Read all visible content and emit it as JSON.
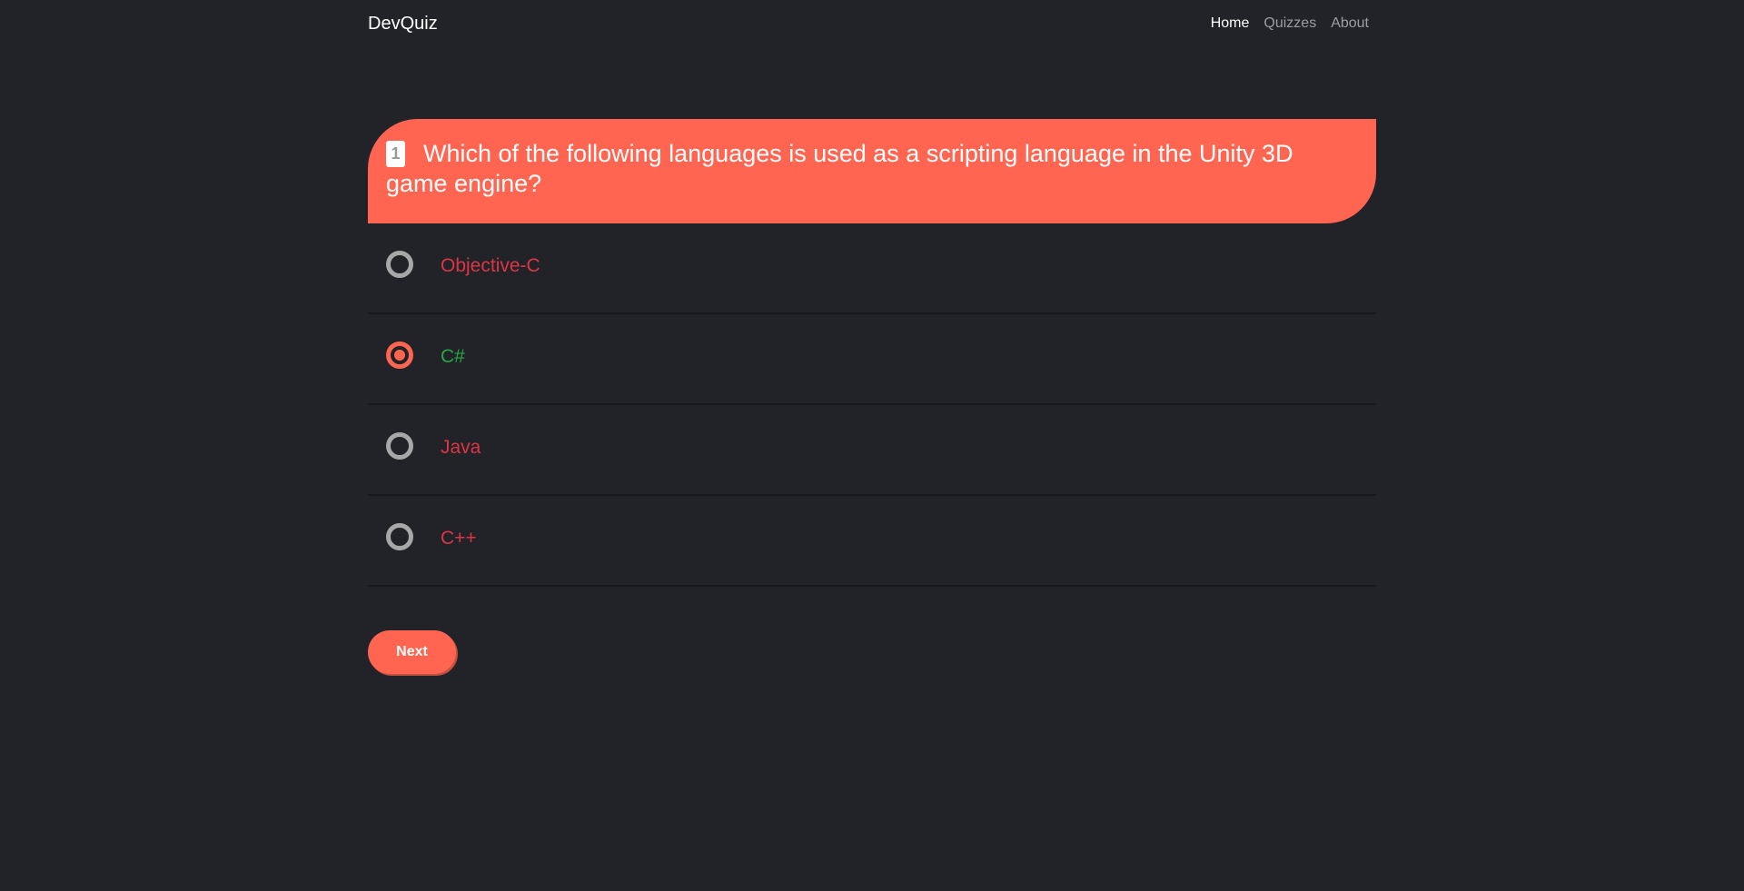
{
  "navbar": {
    "brand": "DevQuiz",
    "links": [
      {
        "label": "Home",
        "active": true
      },
      {
        "label": "Quizzes",
        "active": false
      },
      {
        "label": "About",
        "active": false
      }
    ]
  },
  "question": {
    "number": "1",
    "text": "Which of the following languages is used as a scripting language in the Unity 3D game engine?"
  },
  "options": [
    {
      "label": "Objective-C",
      "selected": false,
      "color": "#dc3545"
    },
    {
      "label": "C#",
      "selected": true,
      "color": "#28a745"
    },
    {
      "label": "Java",
      "selected": false,
      "color": "#dc3545"
    },
    {
      "label": "C++",
      "selected": false,
      "color": "#dc3545"
    }
  ],
  "next_label": "Next",
  "colors": {
    "accent": "#ff6550",
    "background": "#212328",
    "correct": "#28a745",
    "incorrect": "#dc3545"
  }
}
